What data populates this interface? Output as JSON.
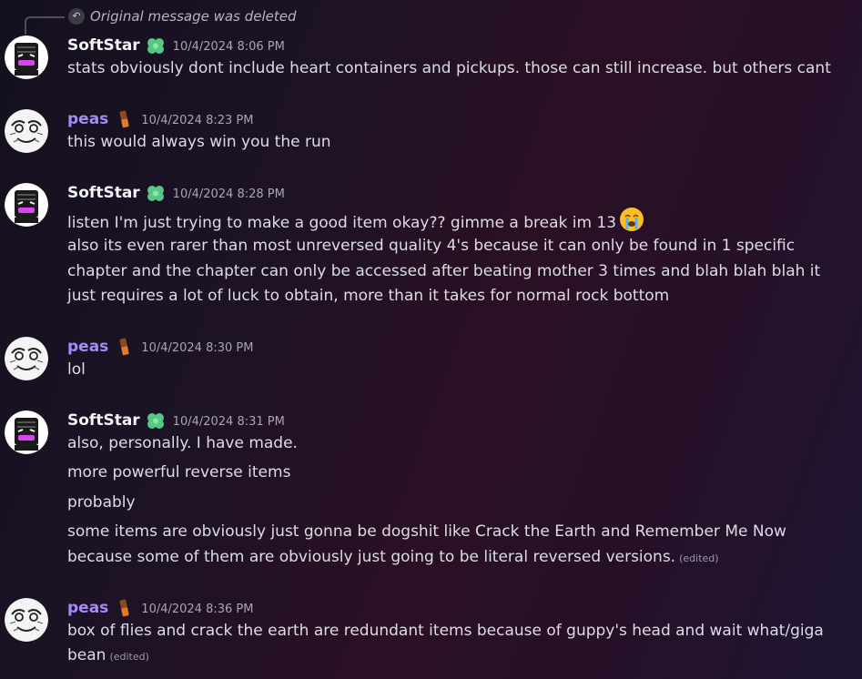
{
  "reply": {
    "icon": "reply-arrow-icon",
    "text": "Original message was deleted"
  },
  "users": {
    "softstar": {
      "name": "SoftStar",
      "color": "#f2f3f5",
      "badge_icon": "green-clover-icon",
      "avatar_icon": "black-box-character-avatar"
    },
    "peas": {
      "name": "peas",
      "color": "#a78bfa",
      "badge_icon": "chocolate-bar-icon",
      "avatar_icon": "sketch-face-avatar"
    }
  },
  "messages": [
    {
      "author": "SoftStar",
      "timestamp": "10/4/2024 8:06 PM",
      "lines": [
        "stats obviously dont include heart containers and pickups. those can still increase. but others cant"
      ]
    },
    {
      "author": "peas",
      "timestamp": "10/4/2024 8:23 PM",
      "lines": [
        "this would always win you the run"
      ]
    },
    {
      "author": "SoftStar",
      "timestamp": "10/4/2024 8:28 PM",
      "lines": [
        "listen I'm just trying to make a good item okay?? gimme a break im 13",
        "also its even rarer than most unreversed quality 4's because it can only be found in 1 specific",
        "chapter and the chapter can only be accessed after beating mother 3 times and blah blah blah it",
        "just requires a lot of luck to obtain, more than it takes for normal rock bottom"
      ],
      "emoji": "loudly-crying-face-icon"
    },
    {
      "author": "peas",
      "timestamp": "10/4/2024 8:30 PM",
      "lines": [
        "lol"
      ]
    },
    {
      "author": "SoftStar",
      "timestamp": "10/4/2024 8:31 PM",
      "lines": [
        "also, personally. I have made.",
        "more powerful reverse items",
        "probably",
        "some items are obviously just gonna be dogshit like Crack the Earth and Remember Me Now",
        "because some of them are obviously just going to be literal reversed versions."
      ],
      "edited": "(edited)"
    },
    {
      "author": "peas",
      "timestamp": "10/4/2024 8:36 PM",
      "lines": [
        "box of flies and crack the earth are redundant items because of guppy's head and wait what/giga",
        "bean"
      ],
      "edited": "(edited)"
    }
  ]
}
